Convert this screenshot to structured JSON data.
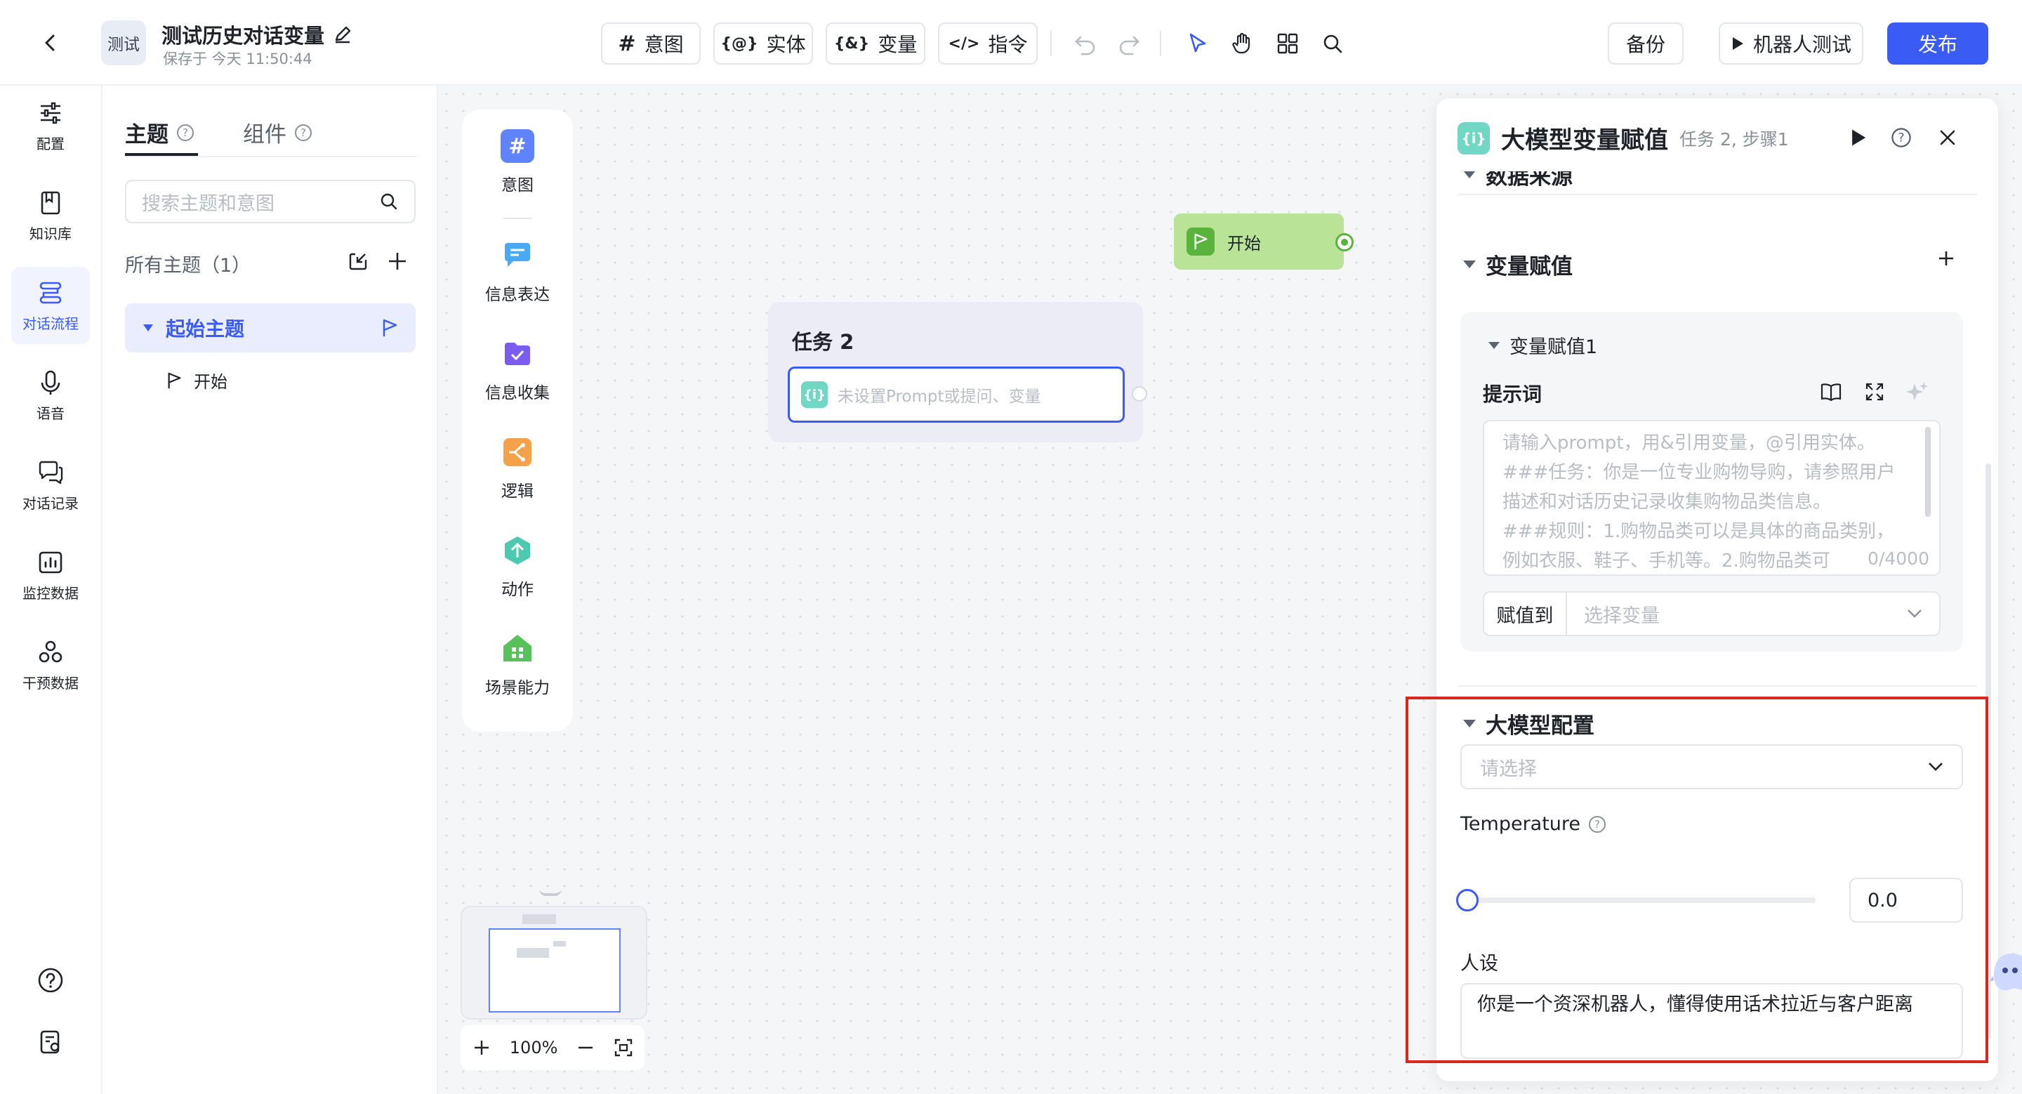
{
  "header": {
    "project_badge": "测试",
    "title": "测试历史对话变量",
    "saved_status": "保存于 今天 11:50:44",
    "tabs": [
      {
        "label": "意图",
        "icon": "hash-icon"
      },
      {
        "label": "实体",
        "icon": "entity-icon"
      },
      {
        "label": "变量",
        "icon": "variable-icon"
      },
      {
        "label": "指令",
        "icon": "code-icon"
      }
    ],
    "backup_label": "备份",
    "test_label": "机器人测试",
    "publish_label": "发布",
    "accent": "#3b5bf5"
  },
  "left_nav": {
    "items": [
      {
        "label": "配置",
        "icon": "sliders-icon"
      },
      {
        "label": "知识库",
        "icon": "book-icon"
      },
      {
        "label": "对话流程",
        "icon": "flow-icon",
        "active": true
      },
      {
        "label": "语音",
        "icon": "mic-icon"
      },
      {
        "label": "对话记录",
        "icon": "chat-icon"
      },
      {
        "label": "监控数据",
        "icon": "chart-icon"
      },
      {
        "label": "干预数据",
        "icon": "nodes-icon"
      }
    ]
  },
  "topic_panel": {
    "tabs": [
      {
        "label": "主题"
      },
      {
        "label": "组件"
      }
    ],
    "search_placeholder": "搜索主题和意图",
    "all_topics_label": "所有主题（1）",
    "topic_name": "起始主题",
    "topic_child": "开始"
  },
  "palette": {
    "items": [
      {
        "label": "意图",
        "icon": "hash-icon",
        "color": "#4d7cfe"
      },
      {
        "label": "信息表达",
        "icon": "message-icon",
        "color": "#4aa9f5"
      },
      {
        "label": "信息收集",
        "icon": "collect-icon",
        "color": "#7b5cf0"
      },
      {
        "label": "逻辑",
        "icon": "logic-icon",
        "color": "#f5a14a"
      },
      {
        "label": "动作",
        "icon": "action-icon",
        "color": "#4cc9b0"
      },
      {
        "label": "场景能力",
        "icon": "scene-icon",
        "color": "#58c25a"
      }
    ]
  },
  "canvas": {
    "task_title": "任务 2",
    "task_placeholder": "未设置Prompt或提问、变量",
    "start_label": "开始",
    "zoom": "100%"
  },
  "right_panel": {
    "title": "大模型变量赋值",
    "subtitle": "任务 2, 步骤1",
    "data_source_label": "数据来源",
    "assign_section": "变量赋值",
    "assign_item": "变量赋值1",
    "prompt_label": "提示词",
    "prompt_placeholder": "请输入prompt，用&引用变量，@引用实体。\n###任务：你是一位专业购物导购，请参照用户描述和对话历史记录收集购物品类信息。\n###规则：1.购物品类可以是具体的商品类别，例如衣服、鞋子、手机等。2.购物品类可",
    "prompt_counter": "0/4000",
    "assign_to_label": "赋值到",
    "assign_to_placeholder": "选择变量",
    "llm_section": "大模型配置",
    "llm_select_placeholder": "请选择",
    "temperature_label": "Temperature",
    "temperature_value": "0.0",
    "temperature_fraction": 0.0,
    "persona_label": "人设",
    "persona_value": "你是一个资深机器人，懂得使用话术拉近与客户距离"
  }
}
